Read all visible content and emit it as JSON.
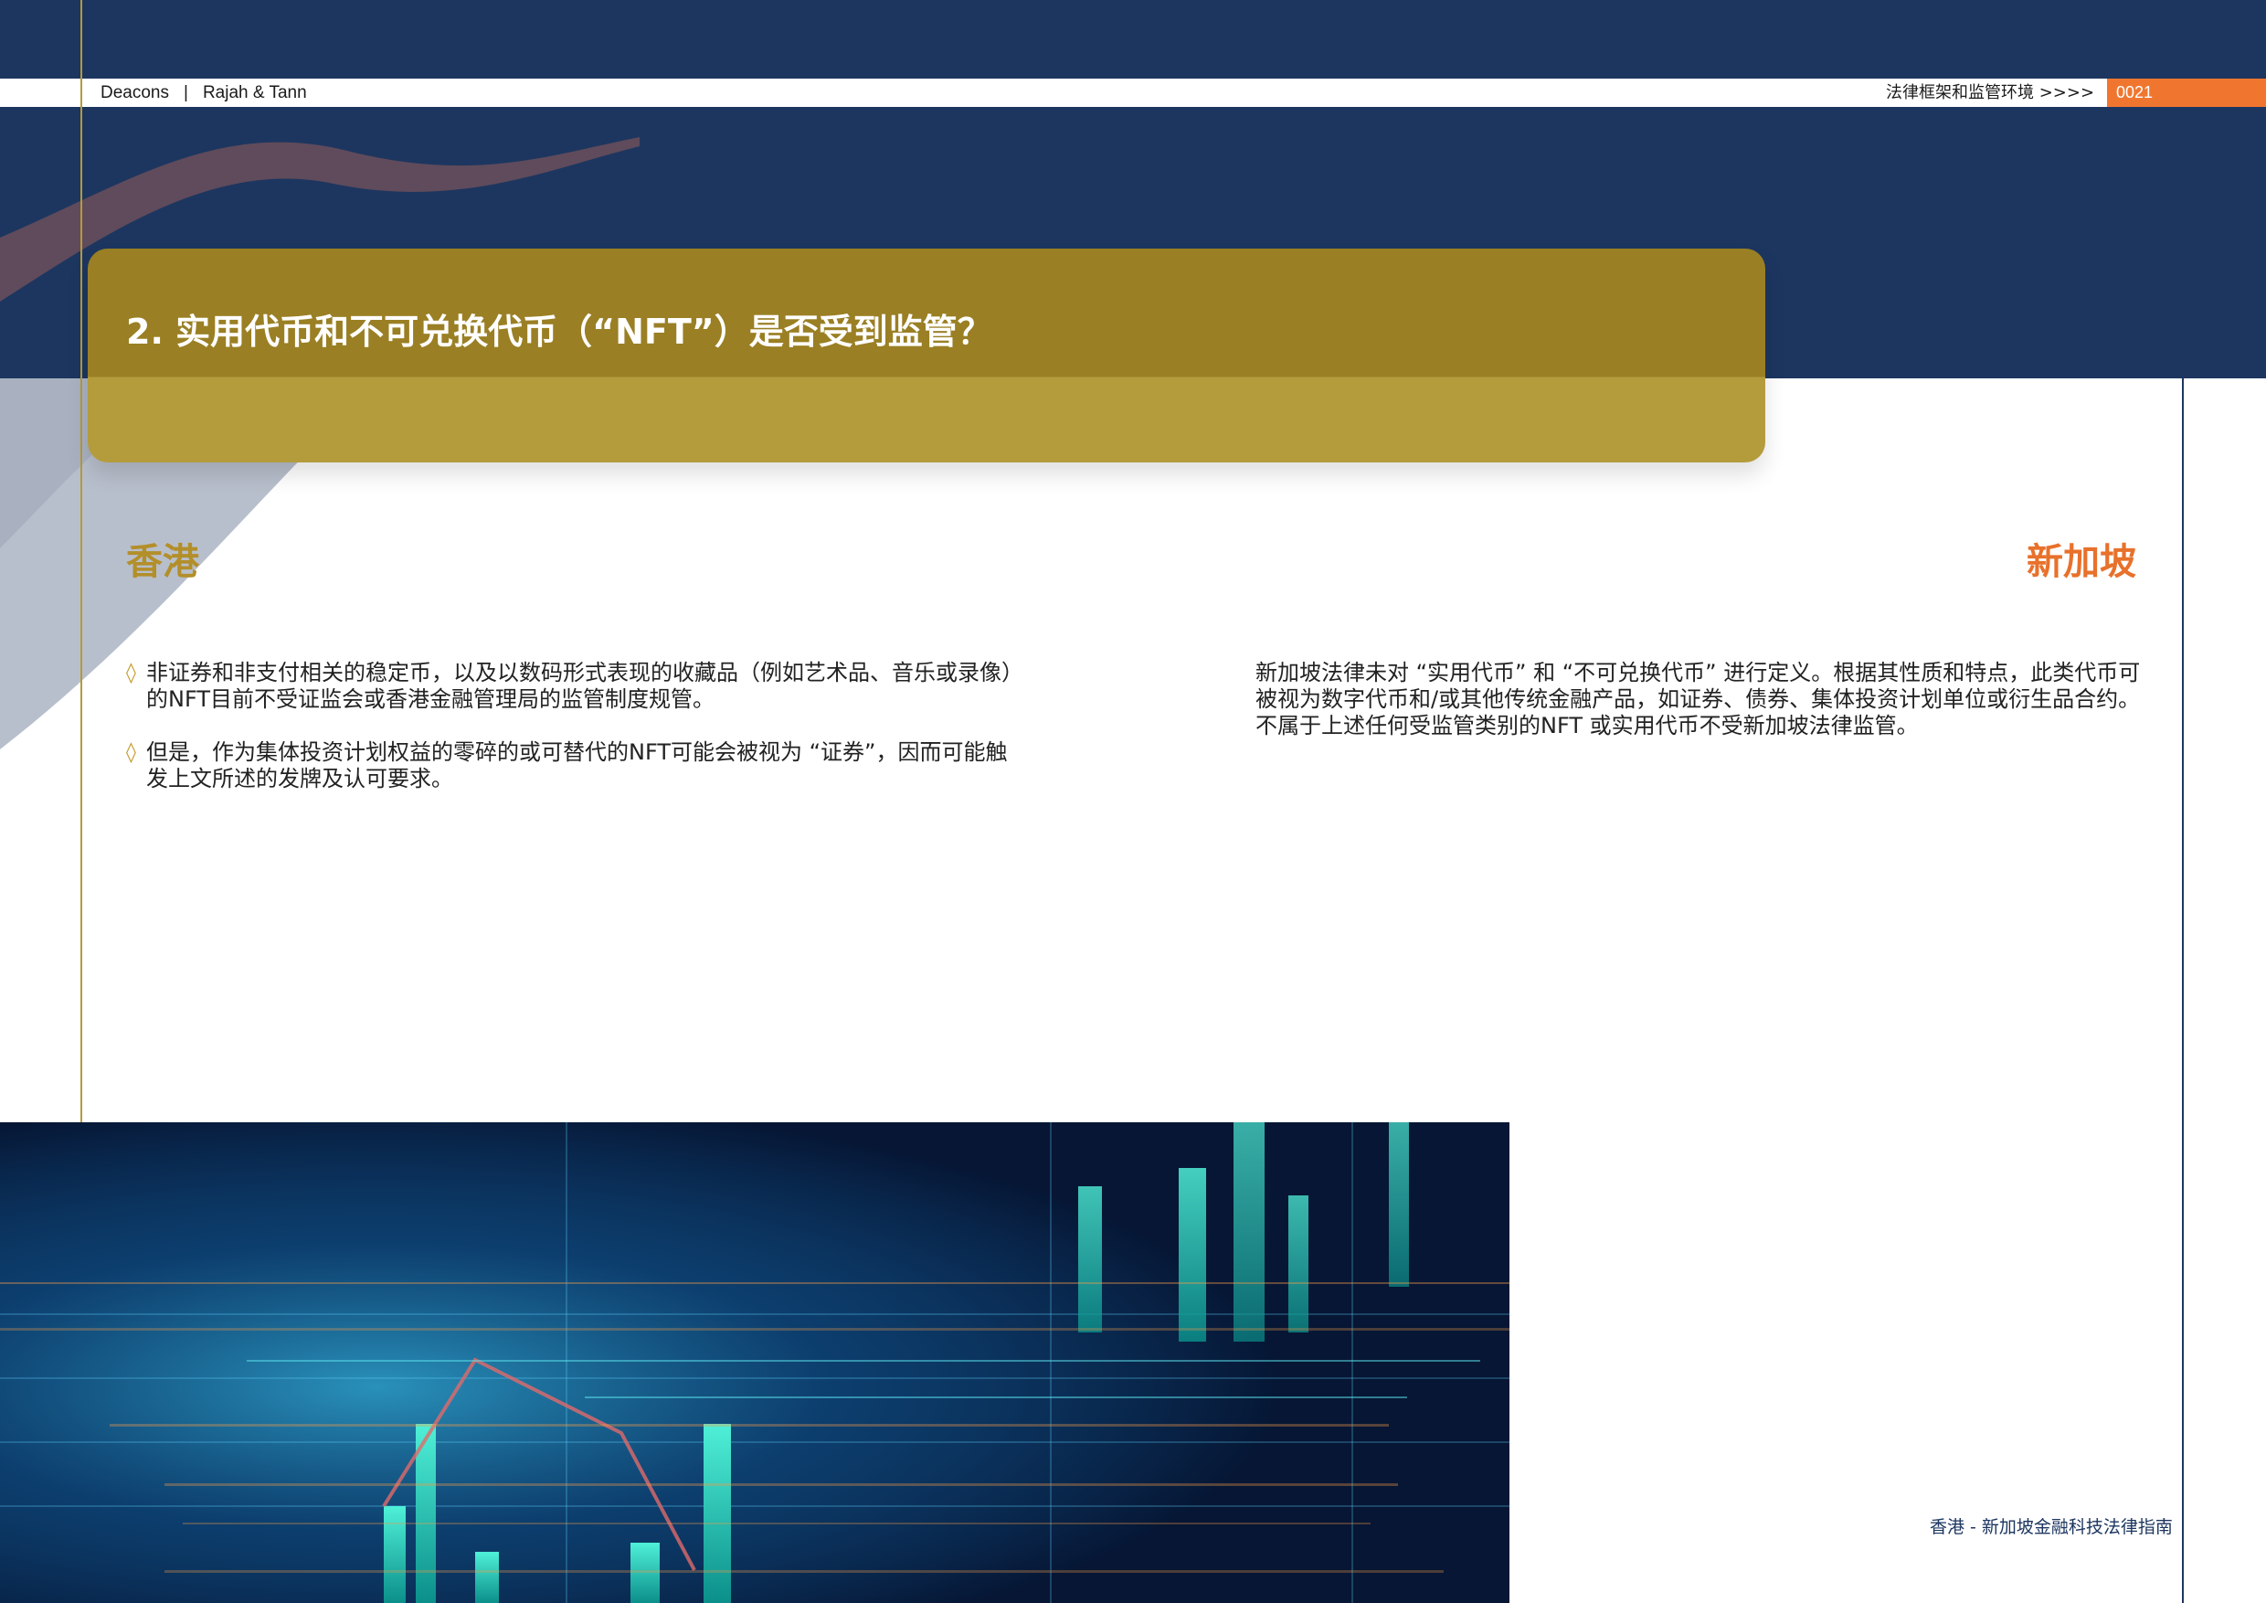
{
  "header": {
    "brand_left": "Deacons",
    "brand_separator": "|",
    "brand_right": "Rajah & Tann",
    "section_crumb": "法律框架和监管环境 >>>>",
    "page_number": "0021"
  },
  "title": "2. 实用代币和不可兑换代币（“NFT”）是否受到监管？",
  "hong_kong": {
    "heading": "香港",
    "bullet_symbol": "◊",
    "items": [
      "非证券和非支付相关的稳定币，以及以数码形式表现的收藏品（例如艺术品、音乐或录像）的NFT目前不受证监会或香港金融管理局的监管制度规管。",
      "但是，作为集体投资计划权益的零碎的或可替代的NFT可能会被视为 “证券”，因而可能触发上文所述的发牌及认可要求。"
    ]
  },
  "singapore": {
    "heading": "新加坡",
    "paragraph": "新加坡法律未对 “实用代币” 和 “不可兑换代币” 进行定义。根据其性质和特点，此类代币可被视为数字代币和/或其他传统金融产品，如证券、债券、集体投资计划单位或衍生品合约。不属于上述任何受监管类别的NFT 或实用代币不受新加坡法律监管。"
  },
  "footer": {
    "note": "香港 - 新加坡金融科技法律指南"
  },
  "colors": {
    "navy": "#1d3660",
    "gold": "#9a7f24",
    "gold_light": "#b49c3c",
    "orange": "#f07630",
    "hk_heading": "#b38f2a",
    "sg_heading": "#e8712b"
  }
}
